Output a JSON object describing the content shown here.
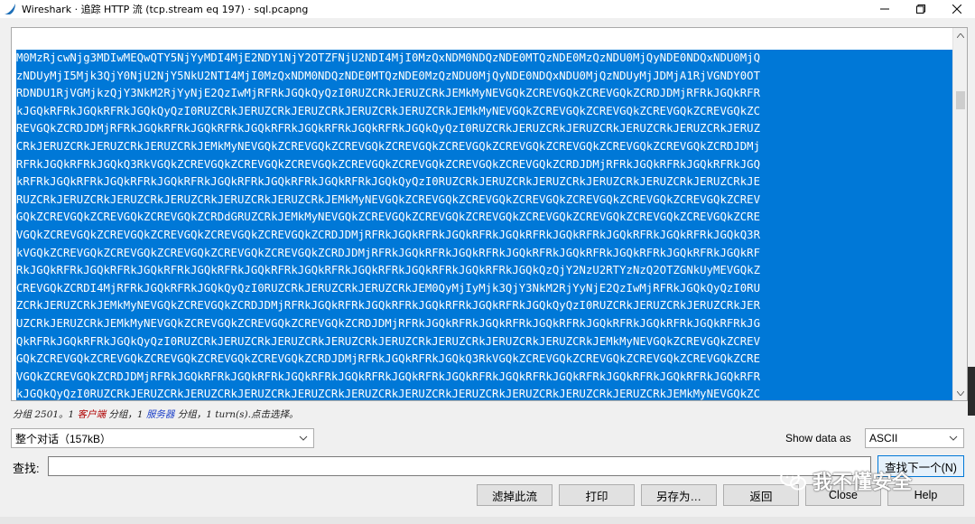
{
  "window": {
    "title": "Wireshark · 追踪 HTTP 流 (tcp.stream eq 197) · sql.pcapng",
    "app_icon": "wireshark-fin-icon",
    "controls": [
      "minimize-icon",
      "maximize-icon",
      "close-icon"
    ]
  },
  "stream": {
    "lines": [
      "M0MzRjcwNjg3MDIwMEQwQTY5NjYyMDI4MjE2NDY1NjY2OTZFNjU2NDI4MjI0MzQxNDM0NDQzNDE0MTQzNDE0MzQzNDU0MjQyNDE0NDQxNDU0MjQ",
      "zNDUyMjI5Mjk3QjY0NjU2NjY5NkU2NTI4MjI0MzQxNDM0NDQzNDE0MTQzNDE0MzQzNDU0MjQyNDE0NDQxNDU0MjQzNDUyMjJDMjA1RjVGNDY0OT",
      "RDNDU1RjVGMjkzQjY3NkM2RjYyNjE2QzIwMjRFRkJGQkQyQzI0RUZCRkJERUZCRkJEMkMyNEVGQkZCREVGQkZCREVGQkZCRDJDMjRFRkJGQkRFR",
      "kJGQkRFRkJGQkRFRkJGQkQyQzI0RUZCRkJERUZCRkJERUZCRkJERUZCRkJERUZCRkJEMkMyNEVGQkZCREVGQkZCREVGQkZCREVGQkZCREVGQkZC",
      "REVGQkZCRDJDMjRFRkJGQkRFRkJGQkRFRkJGQkRFRkJGQkRFRkJGQkRFRkJGQkQyQzI0RUZCRkJERUZCRkJERUZCRkJERUZCRkJERUZCRkJERUZ",
      "CRkJERUZCRkJERUZCRkJERUZCRkJEMkMyNEVGQkZCREVGQkZCREVGQkZCREVGQkZCREVGQkZCREVGQkZCREVGQkZCREVGQkZCREVGQkZCRDJDMj",
      "RFRkJGQkRFRkJGQkQ3RkVGQkZCREVGQkZCREVGQkZCREVGQkZCREVGQkZCREVGQkZCREVGQkZCREVGQkZCRDJDMjRFRkJGQkRFRkJGQkRFRkJGQ",
      "kRFRkJGQkRFRkJGQkRFRkJGQkRFRkJGQkRFRkJGQkRFRkJGQkRFRkJGQkQyQzI0RUZCRkJERUZCRkJERUZCRkJERUZCRkJERUZCRkJERUZCRkJE",
      "RUZCRkJERUZCRkJERUZCRkJERUZCRkJERUZCRkJERUZCRkJEMkMyNEVGQkZCREVGQkZCREVGQkZCREVGQkZCREVGQkZCREVGQkZCREVGQkZCREV",
      "GQkZCREVGQkZCREVGQkZCREVGQkZCRDdGRUZCRkJEMkMyNEVGQkZCREVGQkZCREVGQkZCREVGQkZCREVGQkZCREVGQkZCREVGQkZCREVGQkZCRE",
      "VGQkZCREVGQkZCREVGQkZCREVGQkZCREVGQkZCREVGQkZCRDJDMjRFRkJGQkRFRkJGQkRFRkJGQkRFRkJGQkRFRkJGQkRFRkJGQkRFRkJGQkQ3R",
      "kVGQkZCREVGQkZCREVGQkZCREVGQkZCREVGQkZCREVGQkZCRDJDMjRFRkJGQkRFRkJGQkRFRkJGQkRFRkJGQkRFRkJGQkRFRkJGQkRFRkJGQkRF",
      "RkJGQkRFRkJGQkRFRkJGQkRFRkJGQkRFRkJGQkRFRkJGQkRFRkJGQkRFRkJGQkRFRkJGQkRFRkJGQkQzQjY2NzU2RTYzNzQ2OTZGNkUyMEVGQkZ",
      "CREVGQkZCRDI4MjRFRkJGQkRFRkJGQkQyQzI0RUZCRkJERUZCRkJERUZCRkJEM0QyMjIyMjk3QjY3NkM2RjYyNjE2QzIwMjRFRkJGQkQyQzI0RU",
      "ZCRkJERUZCRkJEMkMyNEVGQkZCREVGQkZCRDJDMjRFRkJGQkRFRkJGQkRFRkJGQkRFRkJGQkRFRkJGQkQyQzI0RUZCRkJERUZCRkJERUZCRkJER",
      "UZCRkJERUZCRkJEMkMyNEVGQkZCREVGQkZCREVGQkZCREVGQkZCRDJDMjRFRkJGQkRFRkJGQkRFRkJGQkRFRkJGQkRFRkJGQkRFRkJGQkRFRkJG",
      "QkRFRkJGQkRFRkJGQkQyQzI0RUZCRkJERUZCRkJERUZCRkJERUZCRkJERUZCRkJERUZCRkJERUZCRkJERUZCRkJEMkMyNEVGQkZCREVGQkZCREV",
      "GQkZCREVGQkZCREVGQkZCREVGQkZCREVGQkZCREVGQkZCRDJDMjRFRkJGQkRFRkJGQkQ3RkVGQkZCREVGQkZCREVGQkZCREVGQkZCREVGQkZCRE",
      "VGQkZCREVGQkZCRDJDMjRFRkJGQkRFRkJGQkRFRkJGQkRFRkJGQkRFRkJGQkRFRkJGQkRFRkJGQkRFRkJGQkRFRkJGQkRFRkJGQkRFRkJGQkRFR",
      "kJGQkQyQzI0RUZCRkJERUZCRkJERUZCRkJERUZCRkJERUZCRkJERUZCRkJERUZCRkJERUZCRkJERUZCRkJERUZCRkJERUZCRkJEMkMyNEVGQkZC"
    ]
  },
  "status": {
    "prefix": "分组 2501。1 ",
    "client": "客户端",
    "mid": " 分组，1 ",
    "server": "服务器",
    "suffix": " 分组，1 turn(s).点击选择。"
  },
  "conversation_select": {
    "value": "整个对话（157kB）"
  },
  "show_data": {
    "label": "Show data as",
    "value": "ASCII"
  },
  "find": {
    "label": "查找:",
    "value": "",
    "next_label": "查找下一个(N)"
  },
  "buttons": {
    "filter_out": "滤掉此流",
    "print": "打印",
    "save_as": "另存为…",
    "back": "返回",
    "close": "Close",
    "help": "Help"
  },
  "watermark": {
    "text": "我不懂安全",
    "icon": "wechat-icon"
  }
}
